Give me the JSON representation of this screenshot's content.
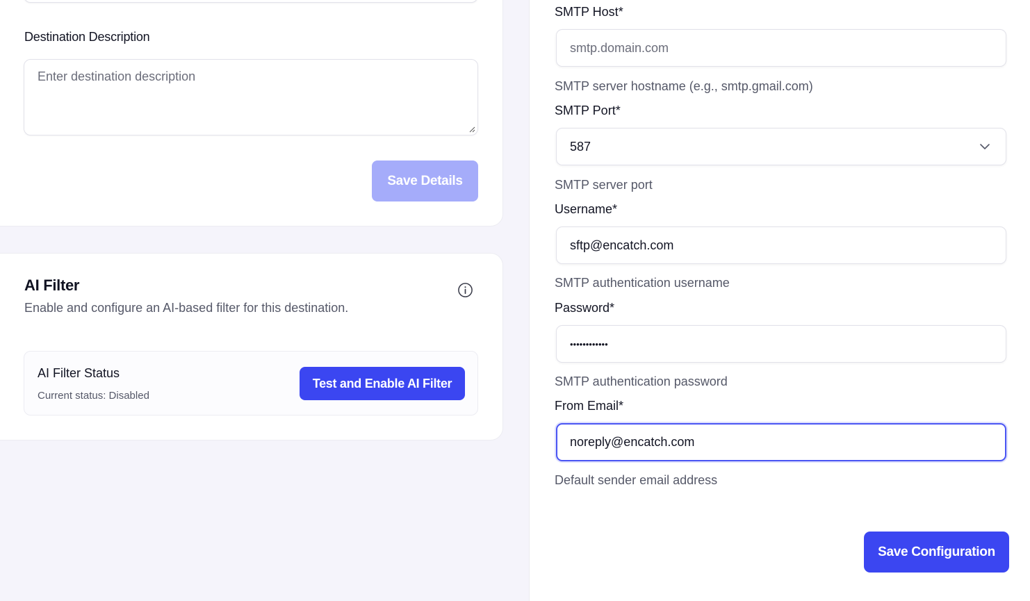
{
  "destination": {
    "description_label": "Destination Description",
    "description_placeholder": "Enter destination description",
    "save_details_label": "Save Details"
  },
  "ai_filter": {
    "title": "AI Filter",
    "description": "Enable and configure an AI-based filter for this destination.",
    "status_title": "AI Filter Status",
    "status_text": "Current status: Disabled",
    "enable_button_label": "Test and Enable AI Filter",
    "info_icon": "info-icon"
  },
  "smtp": {
    "host": {
      "label": "SMTP Host*",
      "placeholder": "smtp.domain.com",
      "value": "",
      "help": "SMTP server hostname (e.g., smtp.gmail.com)"
    },
    "port": {
      "label": "SMTP Port*",
      "value": "587",
      "help": "SMTP server port"
    },
    "username": {
      "label": "Username*",
      "value": "sftp@encatch.com",
      "help": "SMTP authentication username"
    },
    "password": {
      "label": "Password*",
      "value": "••••••••••••",
      "help": "SMTP authentication password"
    },
    "from_email": {
      "label": "From Email*",
      "value": "noreply@encatch.com",
      "help": "Default sender email address"
    },
    "save_button_label": "Save Configuration"
  },
  "colors": {
    "primary": "#3b46f1",
    "primary_disabled": "#a5acfa",
    "focus_ring": "#4a55f3",
    "background": "#f5f4fb"
  }
}
